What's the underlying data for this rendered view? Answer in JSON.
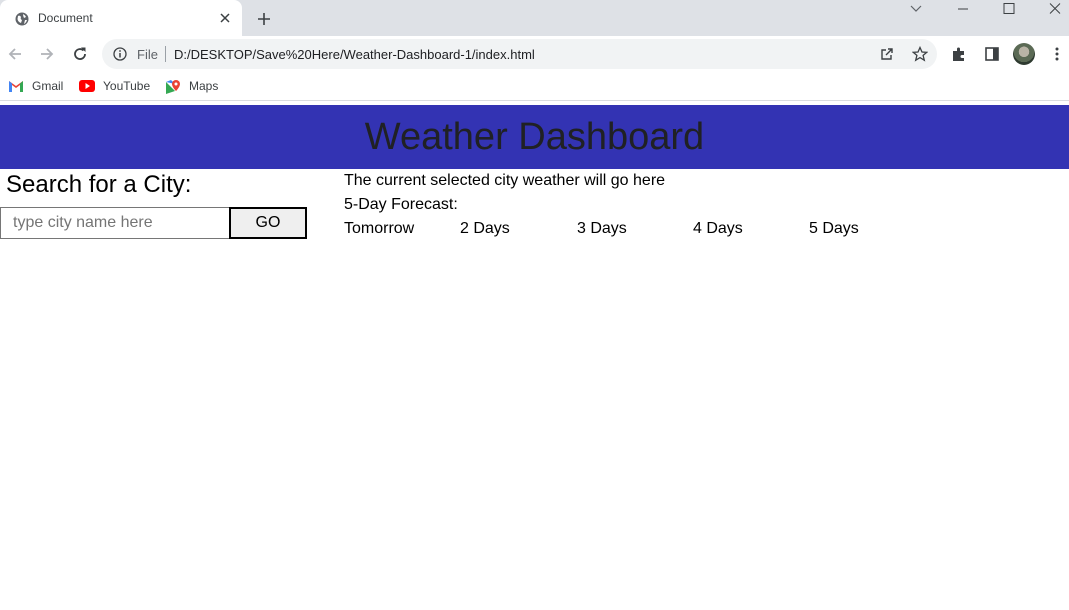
{
  "browser": {
    "tab_title": "Document",
    "address_scheme": "File",
    "address_url": "D:/DESKTOP/Save%20Here/Weather-Dashboard-1/index.html",
    "bookmarks": [
      "Gmail",
      "YouTube",
      "Maps"
    ]
  },
  "page": {
    "header_title": "Weather Dashboard",
    "search_title": "Search for a City:",
    "search_placeholder": "type city name here",
    "go_label": "GO",
    "current_weather_text": "The current selected city weather will go here",
    "forecast_label": "5-Day Forecast:",
    "forecast_days": [
      "Tomorrow",
      "2 Days",
      "3 Days",
      "4 Days",
      "5 Days"
    ]
  },
  "colors": {
    "header_bg": "#3333b3",
    "tabstrip_bg": "#dee1e6"
  }
}
